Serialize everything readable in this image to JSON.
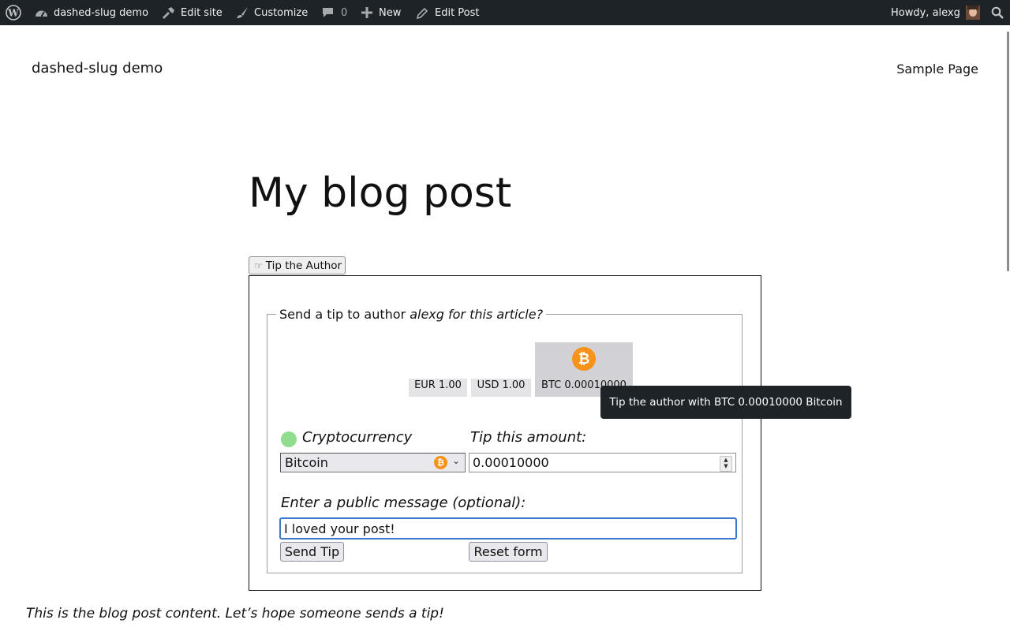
{
  "admin_bar": {
    "site_name": "dashed-slug demo",
    "edit_site": "Edit site",
    "customize": "Customize",
    "comments_count": "0",
    "new": "New",
    "edit_post": "Edit Post",
    "howdy": "Howdy, alexg",
    "icons": [
      "wordpress-logo-icon",
      "dashboard-icon",
      "edit-site-icon",
      "customize-brush-icon",
      "comment-bubble-icon",
      "plus-icon",
      "pencil-icon",
      "user-avatar",
      "search-icon"
    ]
  },
  "header": {
    "site_title": "dashed-slug demo",
    "menu": [
      "Sample Page"
    ]
  },
  "post": {
    "title": "My blog post",
    "content": "This is the blog post content. Let’s hope someone sends a tip!"
  },
  "tip": {
    "toggle_icon": "☞",
    "toggle_label": "Tip the Author",
    "legend_prefix": "Send a tip to author",
    "legend_italic": "alexg for this article?",
    "amount_buttons": [
      {
        "label": "EUR 1.00",
        "active": false
      },
      {
        "label": "USD 1.00",
        "active": false
      },
      {
        "label": "BTC 0.00010000",
        "active": true,
        "icon": "bitcoin-icon"
      }
    ],
    "tooltip": "Tip the author with BTC 0.00010000 Bitcoin",
    "crypto_label": "Cryptocurrency",
    "crypto_status_color": "#90dd90",
    "crypto_selected": "Bitcoin",
    "amount_label": "Tip this amount:",
    "amount_value": "0.00010000",
    "message_label": "Enter a public message (optional):",
    "message_value": "I loved your post!",
    "send_label": "Send Tip",
    "reset_label": "Reset form"
  },
  "colors": {
    "admin_bar_bg": "#1d2327",
    "bitcoin_orange": "#f7931a",
    "focus_blue": "#3a78c9"
  }
}
